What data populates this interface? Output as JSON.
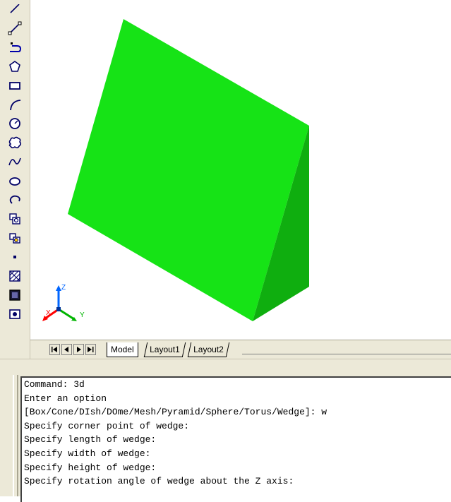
{
  "toolbar": {
    "tools": [
      {
        "name": "construction-line-icon"
      },
      {
        "name": "line-icon"
      },
      {
        "name": "polyline-icon"
      },
      {
        "name": "polygon-icon"
      },
      {
        "name": "rectangle-icon"
      },
      {
        "name": "arc-icon"
      },
      {
        "name": "circle-icon"
      },
      {
        "name": "revision-cloud-icon"
      },
      {
        "name": "spline-icon"
      },
      {
        "name": "ellipse-icon"
      },
      {
        "name": "ellipse-arc-icon"
      },
      {
        "name": "insert-block-icon"
      },
      {
        "name": "make-block-icon"
      },
      {
        "name": "point-icon"
      },
      {
        "name": "hatch-icon"
      },
      {
        "name": "gradient-icon"
      },
      {
        "name": "region-icon"
      }
    ]
  },
  "viewport": {
    "ucs": {
      "x": "X",
      "y": "Y",
      "z": "Z"
    },
    "wedge_colors": {
      "front": "#16e316",
      "side": "#0fae0f"
    }
  },
  "tabs": {
    "items": [
      "Model",
      "Layout1",
      "Layout2"
    ],
    "active": "Model"
  },
  "command": {
    "lines": [
      "Command: 3d",
      "Enter an option",
      "[Box/Cone/DIsh/DOme/Mesh/Pyramid/Sphere/Torus/Wedge]: w",
      "Specify corner point of wedge:",
      "Specify length of wedge:",
      "Specify width of wedge:",
      "Specify height of wedge:",
      "Specify rotation angle of wedge about the Z axis:"
    ]
  }
}
